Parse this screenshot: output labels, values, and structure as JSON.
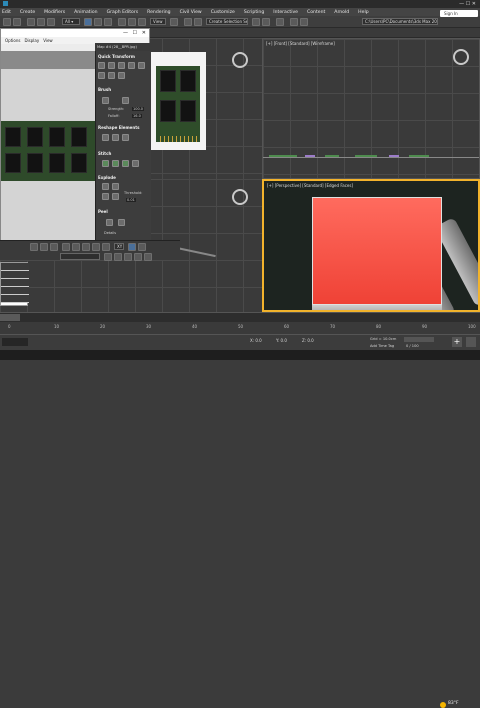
{
  "window": {
    "title": "Autodesk 3ds Max 2021",
    "file": "Untitled",
    "workspace": "Workspaces: Default",
    "project_path": "C:\\Users\\PC\\Documents\\3ds Max 2021 ▾",
    "search_placeholder": "Sign In"
  },
  "menu": [
    "Edit",
    "Create",
    "Modifiers",
    "Animation",
    "Graph Editors",
    "Rendering",
    "Civil View",
    "Customize",
    "Scripting",
    "Interactive",
    "Content",
    "Arnold",
    "Help"
  ],
  "toolbar": {
    "view_select": "View",
    "selection_set": "Create Selection Set"
  },
  "editor": {
    "title": "",
    "menu": [
      "Options",
      "Display",
      "View"
    ],
    "image_name": "Map #4 (28__BPR.jpg)",
    "uv_label": "UV",
    "sections": {
      "quick": "Quick Transform",
      "brush": "Brush",
      "reshape": "Reshape Elements",
      "stitch": "Stitch",
      "explode": "Explode",
      "peel": "Peel"
    },
    "strength_label": "Strength:",
    "strength_value": "100.0",
    "falloff_label": "Falloff:",
    "falloff_value": "16.0",
    "threshold_label": "Threshold:",
    "threshold_value": "0.01",
    "details_label": "Details",
    "uv_mode": "UV",
    "zoom_select": "XY"
  },
  "viewports": {
    "front": "[+] [Front] [Standard] [Wireframe]",
    "perspective": "[+] [Perspective] [Standard] [Edged Faces]"
  },
  "timeline": {
    "ticks": [
      "0",
      "10",
      "20",
      "30",
      "40",
      "50",
      "60",
      "70",
      "80",
      "90",
      "100"
    ],
    "frame": "0 / 100"
  },
  "status": {
    "coords": {
      "x": "X: 0.0",
      "y": "Y: 0.0",
      "z": "Z: 0.0"
    },
    "grid": "Grid = 10.0cm",
    "add_time_tag": "Add Time Tag",
    "autokey": "Auto Key",
    "selected": "Selected",
    "set_key": "Set Key",
    "key_filters": "Key Filters..."
  },
  "taskbar": {
    "temp": "83°F"
  },
  "list_panel": {
    "rows": [
      "",
      "",
      "",
      "",
      ""
    ]
  }
}
